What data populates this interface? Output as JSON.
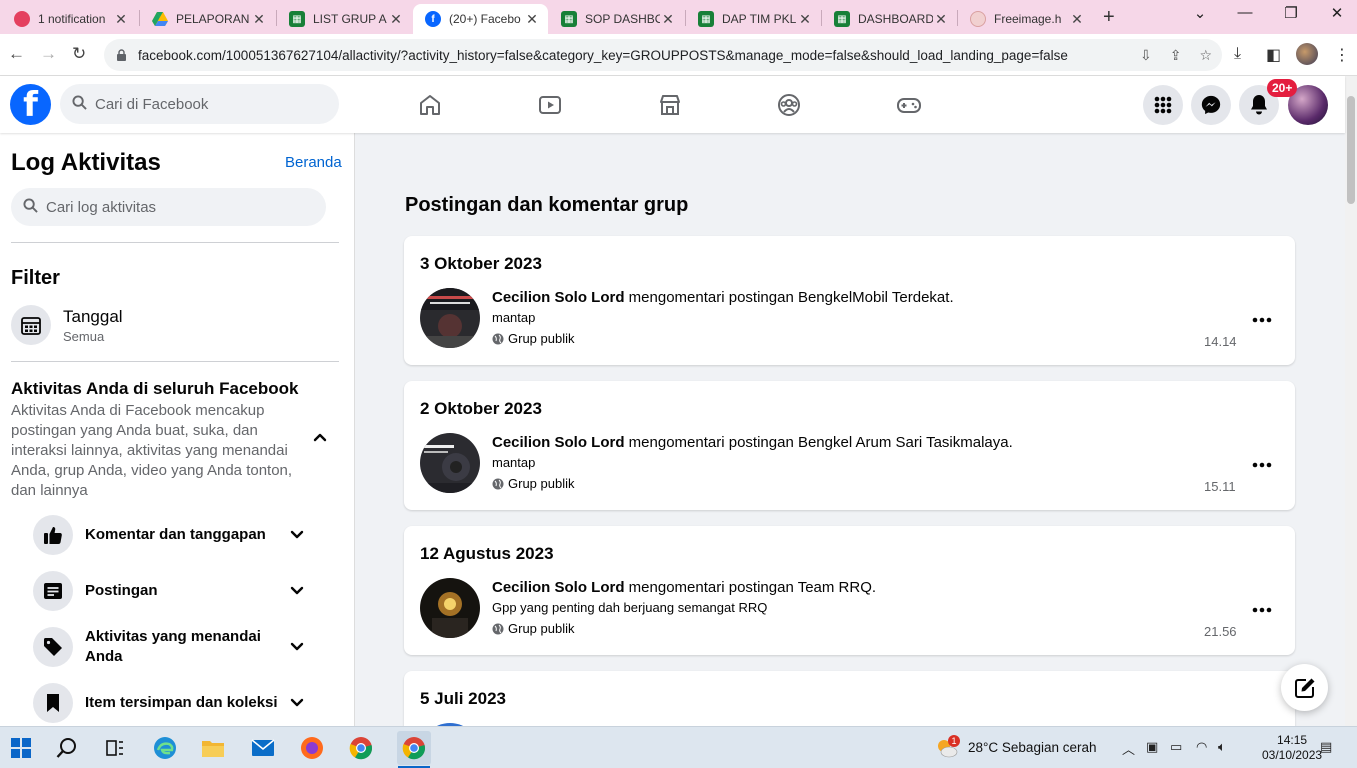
{
  "browser": {
    "tabs": [
      {
        "title": "1 notification",
        "icon": "ig-icon",
        "color": "#e4405f"
      },
      {
        "title": "PELAPORAN",
        "icon": "drive-icon",
        "color": "#1fa463"
      },
      {
        "title": "LIST GRUP A",
        "icon": "sheets-icon",
        "color": "#188038"
      },
      {
        "title": "(20+) Facebo",
        "icon": "facebook-icon",
        "color": "#0866ff"
      },
      {
        "title": "SOP DASHBO",
        "icon": "sheets-icon",
        "color": "#188038"
      },
      {
        "title": "DAP TIM PKL",
        "icon": "sheets-icon",
        "color": "#188038"
      },
      {
        "title": "DASHBOARD",
        "icon": "sheets-icon",
        "color": "#188038"
      },
      {
        "title": "Freeimage.h",
        "icon": "freeimage-icon",
        "color": "#d9b3b3"
      }
    ],
    "url": "facebook.com/100051367627104/allactivity/?activity_history=false&category_key=GROUPPOSTS&manage_mode=false&should_load_landing_page=false"
  },
  "fbnav": {
    "search_placeholder": "Cari di Facebook",
    "notif_badge": "20+",
    "brand_color": "#0866ff"
  },
  "sidebar": {
    "title": "Log Aktivitas",
    "home_link": "Beranda",
    "search_placeholder": "Cari log aktivitas",
    "filter_title": "Filter",
    "date_label": "Tanggal",
    "date_value": "Semua",
    "activity_title": "Aktivitas Anda di seluruh Facebook",
    "activity_desc": "Aktivitas Anda di Facebook mencakup postingan yang Anda buat, suka, dan interaksi lainnya, aktivitas yang menandai Anda, grup Anda, video yang Anda tonton, dan lainnya",
    "items": [
      {
        "label": "Komentar dan tanggapan",
        "icon": "thumbs-up-icon"
      },
      {
        "label": "Postingan",
        "icon": "post-icon"
      },
      {
        "label": "Aktivitas yang menandai Anda",
        "icon": "tag-icon"
      },
      {
        "label": "Item tersimpan dan koleksi",
        "icon": "bookmark-icon"
      }
    ]
  },
  "main": {
    "section_title": "Postingan dan komentar grup",
    "entries": [
      {
        "date": "3 Oktober 2023",
        "actor": "Cecilion Solo Lord",
        "action": " mengomentari postingan ",
        "target": "BengkelMobil Terdekat",
        "comment": "mantap",
        "audience": "Grup publik",
        "time": "14.14"
      },
      {
        "date": "2 Oktober 2023",
        "actor": "Cecilion Solo Lord",
        "action": " mengomentari postingan ",
        "target": "Bengkel Arum Sari Tasikmalaya",
        "comment": "mantap",
        "audience": "Grup publik",
        "time": "15.11"
      },
      {
        "date": "12 Agustus 2023",
        "actor": "Cecilion Solo Lord",
        "action": " mengomentari postingan ",
        "target": "Team RRQ",
        "comment": "Gpp yang penting dah berjuang semangat RRQ",
        "audience": "Grup publik",
        "time": "21.56"
      },
      {
        "date": "5 Juli 2023"
      }
    ]
  },
  "taskbar": {
    "weather": "28°C  Sebagian cerah",
    "weather_badge": "1",
    "time": "14:15",
    "date": "03/10/2023"
  }
}
